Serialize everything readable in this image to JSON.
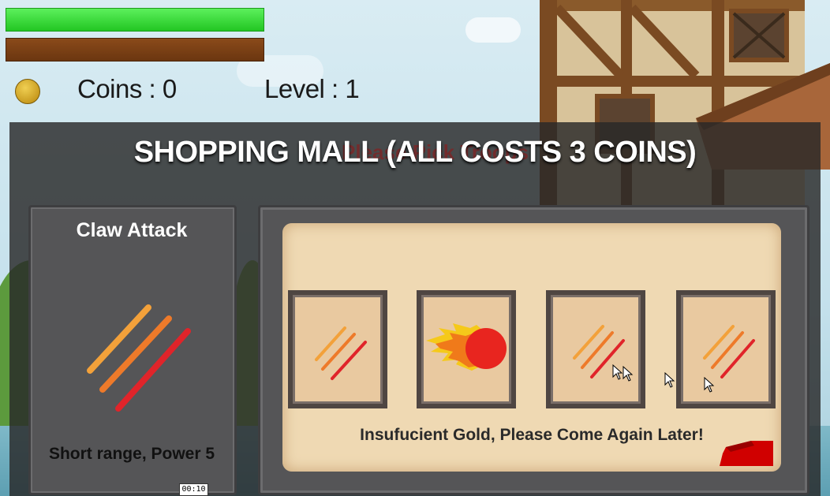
{
  "hud": {
    "health_bar_color": "#3ddc3d",
    "xp_bar_color": "#7a4015",
    "coin_icon": "coin-icon",
    "coins_label": "Coins :",
    "coins_value": "0",
    "level_label": "Level :",
    "level_value": "1"
  },
  "shop": {
    "title": "SHOPPING MALL (ALL COSTS 3 COINS)",
    "background_text": "Please Pick Troops",
    "selected_item": {
      "name": "Claw Attack",
      "icon": "claw-slash-icon",
      "description": "Short range, Power 5"
    },
    "items": [
      {
        "icon": "claw-slash-icon"
      },
      {
        "icon": "fireball-icon"
      },
      {
        "icon": "claw-slash-icon"
      },
      {
        "icon": "claw-slash-icon"
      }
    ],
    "message": "Insufucient Gold, Please Come Again Later!",
    "close_button_color": "#d00000"
  },
  "video_timer": "00:10"
}
